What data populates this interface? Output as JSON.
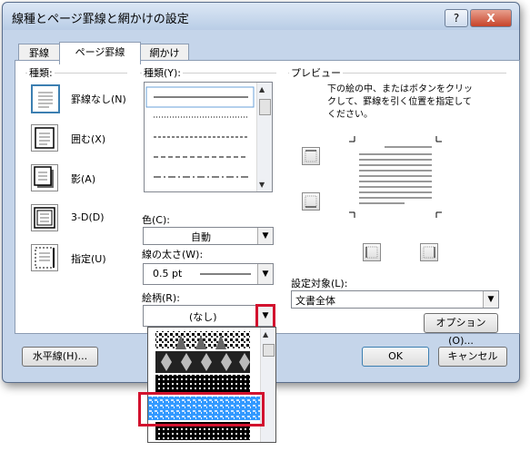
{
  "title": "線種とページ罫線と網かけの設定",
  "titlebar": {
    "help": "?",
    "close": "X"
  },
  "tabs": [
    "罫線",
    "ページ罫線",
    "網かけ"
  ],
  "settings": {
    "label": "種類:",
    "items": [
      "罫線なし(N)",
      "囲む(X)",
      "影(A)",
      "3-D(D)",
      "指定(U)"
    ]
  },
  "style": {
    "label": "種類(Y):"
  },
  "color": {
    "label": "色(C):",
    "value": "自動"
  },
  "width": {
    "label": "線の太さ(W):",
    "value": "0.5 pt"
  },
  "art": {
    "label": "絵柄(R):",
    "value": "(なし)"
  },
  "preview": {
    "label": "プレビュー",
    "instructions": "下の絵の中、またはボタンをクリックして、罫線を引く位置を指定してください。"
  },
  "apply_to": {
    "label": "設定対象(L):",
    "value": "文書全体"
  },
  "buttons": {
    "options": "オプション(O)...",
    "horizontal_line": "水平線(H)...",
    "ok": "OK",
    "cancel": "キャンセル"
  },
  "colors": {
    "highlight": "#d2122e",
    "selected": "#3399ff",
    "titlebar": "#c5d5ea"
  }
}
